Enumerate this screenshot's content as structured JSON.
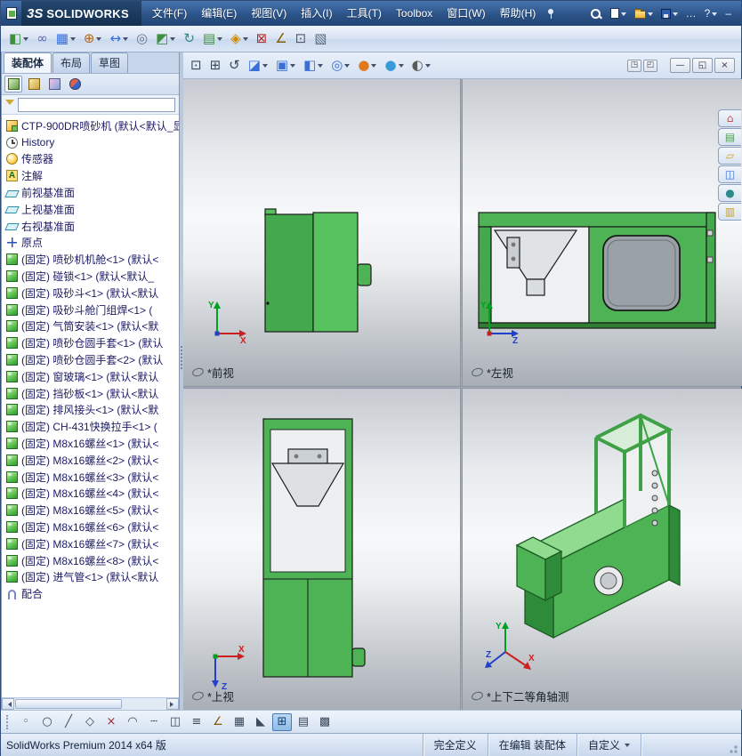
{
  "titlebar": {
    "brand_mark": "3S",
    "brand_name": "SOLIDWORKS",
    "menus": [
      {
        "name": "menu-file",
        "label": "文件(F)"
      },
      {
        "name": "menu-edit",
        "label": "编辑(E)"
      },
      {
        "name": "menu-view",
        "label": "视图(V)"
      },
      {
        "name": "menu-insert",
        "label": "插入(I)"
      },
      {
        "name": "menu-tools",
        "label": "工具(T)"
      },
      {
        "name": "menu-toolbox",
        "label": "Toolbox"
      },
      {
        "name": "menu-window",
        "label": "窗口(W)"
      },
      {
        "name": "menu-help",
        "label": "帮助(H)"
      }
    ],
    "ellipsis_label": "…",
    "help_label": "?",
    "minimize_label": "–"
  },
  "toolbar": {
    "icons": [
      {
        "name": "insert-components-button",
        "glyph": "◧",
        "color": "#3f8f3f",
        "caret": true
      },
      {
        "name": "mate-button",
        "glyph": "∞",
        "color": "#5b6bb5"
      },
      {
        "name": "linear-component-pattern-button",
        "glyph": "▦",
        "color": "#3a6fd8",
        "caret": true
      },
      {
        "name": "smart-fasteners-button",
        "glyph": "⊕",
        "color": "#b5651d",
        "caret": true
      },
      {
        "name": "move-component-button",
        "glyph": "↔",
        "color": "#3a6fd8",
        "caret": true
      },
      {
        "name": "show-hidden-components-button",
        "glyph": "◎",
        "color": "#667788"
      },
      {
        "name": "assembly-features-button",
        "glyph": "◩",
        "color": "#3f8f3f",
        "caret": true
      },
      {
        "name": "new-motion-study-button",
        "glyph": "↻",
        "color": "#2e8b8b"
      },
      {
        "name": "bill-of-materials-button",
        "glyph": "▤",
        "color": "#3f8f3f",
        "caret": true
      },
      {
        "name": "exploded-view-button",
        "glyph": "◈",
        "color": "#d08a00",
        "caret": true
      },
      {
        "name": "interference-detection-button",
        "glyph": "⊠",
        "color": "#b03030"
      },
      {
        "name": "measure-button",
        "glyph": "∠",
        "color": "#806000"
      },
      {
        "name": "mass-properties-button",
        "glyph": "⊡",
        "color": "#555566"
      },
      {
        "name": "section-properties-button",
        "glyph": "▧",
        "color": "#556677"
      }
    ]
  },
  "left_panel": {
    "tabs": [
      {
        "name": "tab-assembly",
        "label": "装配体",
        "active": true
      },
      {
        "name": "tab-layout",
        "label": "布局"
      },
      {
        "name": "tab-sketch",
        "label": "草图"
      }
    ],
    "tabs_overflow": "»",
    "manager_tabs": [
      {
        "name": "featuremanager-tab",
        "kind": "feature",
        "active": true
      },
      {
        "name": "propertymanager-tab",
        "kind": "property"
      },
      {
        "name": "configurationmanager-tab",
        "kind": "config"
      },
      {
        "name": "dimxpertmanager-tab",
        "kind": "dimxpert"
      }
    ],
    "manager_overflow": "»",
    "filter_value": ""
  },
  "tree": {
    "items": [
      {
        "icon": "assembly",
        "icon_name": "assembly-icon",
        "label": "CTP-900DR喷砂机 (默认<默认_显"
      },
      {
        "icon": "history",
        "icon_name": "history-icon",
        "label": "History"
      },
      {
        "icon": "sensor",
        "icon_name": "sensor-icon",
        "label": "传感器"
      },
      {
        "icon": "annotation",
        "icon_name": "annotations-icon",
        "label": "注解"
      },
      {
        "icon": "plane",
        "icon_name": "plane-icon",
        "label": "前视基准面"
      },
      {
        "icon": "plane",
        "icon_name": "plane-icon",
        "label": "上视基准面"
      },
      {
        "icon": "plane",
        "icon_name": "plane-icon",
        "label": "右视基准面"
      },
      {
        "icon": "origin",
        "icon_name": "origin-icon",
        "label": "原点"
      },
      {
        "icon": "part",
        "icon_name": "part-icon",
        "label": "(固定) 喷砂机机舱<1> (默认<"
      },
      {
        "icon": "part",
        "icon_name": "part-icon",
        "label": "(固定) 碰锁<1> (默认<默认_"
      },
      {
        "icon": "part",
        "icon_name": "part-icon",
        "label": "(固定) 吸砂斗<1> (默认<默认"
      },
      {
        "icon": "part",
        "icon_name": "part-icon",
        "label": "(固定) 吸砂斗舱门组焊<1> ("
      },
      {
        "icon": "part",
        "icon_name": "part-icon",
        "label": "(固定) 气筒安装<1> (默认<默"
      },
      {
        "icon": "part",
        "icon_name": "part-icon",
        "label": "(固定) 喷砂仓圆手套<1> (默认"
      },
      {
        "icon": "part",
        "icon_name": "part-icon",
        "label": "(固定) 喷砂仓圆手套<2> (默认"
      },
      {
        "icon": "part",
        "icon_name": "part-icon",
        "label": "(固定) 窗玻璃<1> (默认<默认"
      },
      {
        "icon": "part",
        "icon_name": "part-icon",
        "label": "(固定) 挡砂板<1> (默认<默认"
      },
      {
        "icon": "part",
        "icon_name": "part-icon",
        "label": "(固定) 排风接头<1> (默认<默"
      },
      {
        "icon": "part",
        "icon_name": "part-icon",
        "label": "(固定) CH-431快换拉手<1> ("
      },
      {
        "icon": "part",
        "icon_name": "part-icon",
        "label": "(固定) M8x16螺丝<1> (默认<"
      },
      {
        "icon": "part",
        "icon_name": "part-icon",
        "label": "(固定) M8x16螺丝<2> (默认<"
      },
      {
        "icon": "part",
        "icon_name": "part-icon",
        "label": "(固定) M8x16螺丝<3> (默认<"
      },
      {
        "icon": "part",
        "icon_name": "part-icon",
        "label": "(固定) M8x16螺丝<4> (默认<"
      },
      {
        "icon": "part",
        "icon_name": "part-icon",
        "label": "(固定) M8x16螺丝<5> (默认<"
      },
      {
        "icon": "part",
        "icon_name": "part-icon",
        "label": "(固定) M8x16螺丝<6> (默认<"
      },
      {
        "icon": "part",
        "icon_name": "part-icon",
        "label": "(固定) M8x16螺丝<7> (默认<"
      },
      {
        "icon": "part",
        "icon_name": "part-icon",
        "label": "(固定) M8x16螺丝<8> (默认<"
      },
      {
        "icon": "part",
        "icon_name": "part-icon",
        "label": "(固定) 进气管<1> (默认<默认"
      },
      {
        "icon": "mate",
        "icon_name": "mates-icon",
        "label": "配合"
      }
    ]
  },
  "viewport": {
    "toolbar": [
      {
        "name": "zoom-to-fit-button",
        "glyph": "⊡",
        "color": "#3b4a5a"
      },
      {
        "name": "zoom-to-area-button",
        "glyph": "⊞",
        "color": "#3b4a5a"
      },
      {
        "name": "previous-view-button",
        "glyph": "↺",
        "color": "#3b4a5a"
      },
      {
        "name": "section-view-button",
        "glyph": "◪",
        "color": "#3a6fd8",
        "caret": true
      },
      {
        "name": "view-orientation-button",
        "glyph": "▣",
        "color": "#3a6fd8",
        "caret": true
      },
      {
        "name": "display-style-button",
        "glyph": "◧",
        "color": "#3a6fd8",
        "caret": true
      },
      {
        "name": "hide-show-items-button",
        "glyph": "◎",
        "color": "#3a6fd8",
        "caret": true
      },
      {
        "name": "edit-appearance-button",
        "glyph": "●",
        "color": "#e07a20",
        "caret": true
      },
      {
        "name": "apply-scene-button",
        "glyph": "●",
        "color": "#3a9ad8",
        "caret": true
      },
      {
        "name": "view-settings-button",
        "glyph": "◐",
        "color": "#5a5a5a",
        "caret": true
      }
    ],
    "window_buttons": [
      {
        "name": "viewport-layout-button-1",
        "glyph": "◳",
        "small": true
      },
      {
        "name": "viewport-layout-button-2",
        "glyph": "◰",
        "small": true
      },
      {
        "name": "minimize-document-button",
        "glyph": "—"
      },
      {
        "name": "restore-document-button",
        "glyph": "◱"
      },
      {
        "name": "close-document-button",
        "glyph": "×"
      }
    ],
    "panes": [
      {
        "label": "*前视",
        "axes": [
          "Y",
          "X"
        ]
      },
      {
        "label": "*左视",
        "axes": [
          "Y",
          "Z"
        ]
      },
      {
        "label": "*上视",
        "axes": [
          "X",
          "Z"
        ]
      },
      {
        "label": "*上下二等角轴测",
        "axes": [
          "Y",
          "X",
          "Z"
        ]
      }
    ]
  },
  "taskpane": {
    "tabs": [
      {
        "name": "solidworks-resources-tab",
        "glyph": "⌂",
        "color": "#c0504d"
      },
      {
        "name": "design-library-tab",
        "glyph": "▤",
        "color": "#4f9e4f"
      },
      {
        "name": "file-explorer-tab",
        "glyph": "▱",
        "color": "#d8a020"
      },
      {
        "name": "view-palette-tab",
        "glyph": "◫",
        "color": "#3a6fd8"
      },
      {
        "name": "appearances-scenes-tab",
        "glyph": "●",
        "color": "#2e8b8b"
      },
      {
        "name": "custom-properties-tab",
        "glyph": "▥",
        "color": "#c8a020"
      }
    ]
  },
  "bottom_toolbar": {
    "icons": [
      {
        "name": "point-tool",
        "glyph": "◦",
        "color": "#3b4a5a"
      },
      {
        "name": "circle-tool",
        "glyph": "○",
        "color": "#3b4a5a"
      },
      {
        "name": "line-tool",
        "glyph": "╱",
        "color": "#3b4a5a"
      },
      {
        "name": "polygon-tool",
        "glyph": "◇",
        "color": "#3b4a5a"
      },
      {
        "name": "trim-entities-tool",
        "glyph": "×",
        "color": "#a03030"
      },
      {
        "name": "sketch-fillet-tool",
        "glyph": "◠",
        "color": "#3b4a5a"
      },
      {
        "name": "centerline-tool",
        "glyph": "┄",
        "color": "#3b4a5a"
      },
      {
        "name": "mirror-entities-tool",
        "glyph": "◫",
        "color": "#3b4a5a"
      },
      {
        "name": "offset-entities-tool",
        "glyph": "≡",
        "color": "#3b4a5a"
      },
      {
        "name": "smart-dimension-tool",
        "glyph": "∠",
        "color": "#806000"
      },
      {
        "name": "linear-sketch-pattern-tool",
        "glyph": "▦",
        "color": "#3b4a5a"
      },
      {
        "name": "convert-entities-tool",
        "glyph": "◣",
        "color": "#3b4a5a"
      },
      {
        "name": "four-view-viewport-button",
        "glyph": "⊞",
        "color": "#123f73",
        "active": true
      },
      {
        "name": "view-sheet-button",
        "glyph": "▤",
        "color": "#3b4a5a"
      },
      {
        "name": "grid-snap-button",
        "glyph": "▩",
        "color": "#3b4a5a"
      }
    ]
  },
  "statusbar": {
    "product": "SolidWorks Premium 2014 x64 版",
    "constraint_status": "完全定义",
    "edit_mode": "在编辑 装配体",
    "customize": "自定义"
  },
  "colors": {
    "model_green": "#4db355",
    "model_green_dark": "#2e8b39",
    "model_green_light": "#8fdc8f",
    "axis_x": "#cc2020",
    "axis_y": "#00a020",
    "axis_z": "#2040cc",
    "titlebar_blue": "#2a5186"
  }
}
